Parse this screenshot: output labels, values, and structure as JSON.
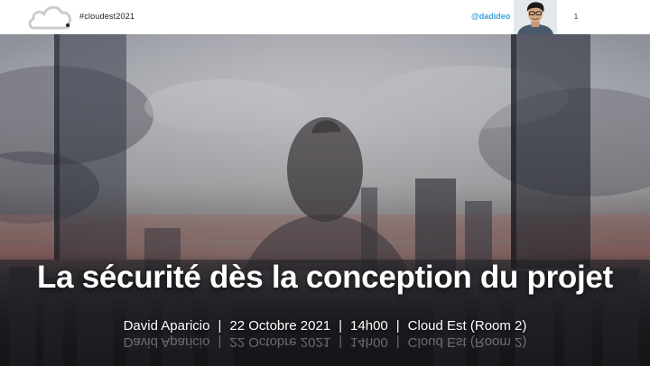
{
  "header": {
    "hashtag": "#cloudest2021",
    "handle": "@dadideo",
    "slide_number": "1"
  },
  "slide": {
    "title": "La sécurité dès la conception du projet",
    "meta": [
      "David Aparicio",
      "22 Octobre 2021",
      "14h00",
      "Cloud Est (Room 2)"
    ],
    "separator": "|"
  },
  "colors": {
    "handle": "#3aa2dd",
    "title": "#ffffff"
  },
  "icons": {
    "logo": "cloud-logo-icon"
  }
}
